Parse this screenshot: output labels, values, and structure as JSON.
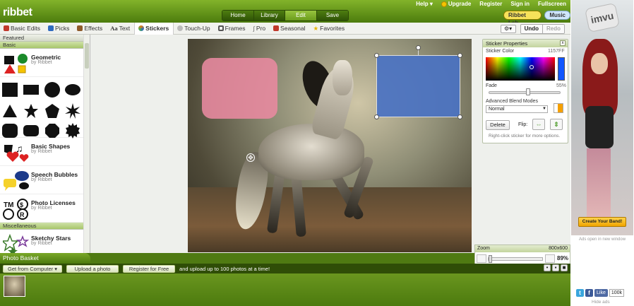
{
  "app": {
    "logo": "ribbet"
  },
  "top_menu": {
    "help": "Help ▾",
    "upgrade": "Upgrade",
    "register": "Register",
    "sign_in": "Sign in",
    "fullscreen": "Fullscreen"
  },
  "nav_tabs": [
    {
      "label": "Home",
      "active": false
    },
    {
      "label": "Library",
      "active": false
    },
    {
      "label": "Edit",
      "active": true
    },
    {
      "label": "Save",
      "active": false
    }
  ],
  "right_buttons": {
    "lab": "Ribbet Lab",
    "music": "Music"
  },
  "tools": [
    {
      "label": "Basic Edits",
      "icon": "crop-icon",
      "color": "#c0392b",
      "active": false
    },
    {
      "label": "Picks",
      "icon": "arrows-icon",
      "color": "#2f6bbf",
      "active": false
    },
    {
      "label": "Effects",
      "icon": "effects-icon",
      "color": "#8e5a2a",
      "active": false
    },
    {
      "label": "Text",
      "icon": "text-icon",
      "color": "#333333",
      "active": false
    },
    {
      "label": "Stickers",
      "icon": "stickers-icon",
      "color": "#e07a1a",
      "active": true
    },
    {
      "label": "Touch-Up",
      "icon": "touchup-icon",
      "color": "#777777",
      "active": false
    },
    {
      "label": "Frames",
      "icon": "frame-icon",
      "color": "#555555",
      "active": false
    },
    {
      "label": "Pro",
      "icon": "pro-icon",
      "color": "#666666",
      "active": false
    },
    {
      "label": "Seasonal",
      "icon": "calendar-icon",
      "color": "#c0392b",
      "active": false
    },
    {
      "label": "Favorites",
      "icon": "star-icon",
      "color": "#e6b400",
      "active": false
    }
  ],
  "toolbar": {
    "gear": "⚙▾",
    "undo": "Undo",
    "redo": "Redo"
  },
  "left_panel": {
    "featured": "Featured",
    "basic": "Basic",
    "misc": "Miscellaneous",
    "geometric": {
      "name": "Geometric",
      "by": "by Ribbet"
    },
    "basic_shapes": {
      "name": "Basic Shapes",
      "by": "by Ribbet"
    },
    "speech": {
      "name": "Speech Bubbles",
      "by": "by Ribbet"
    },
    "licenses": {
      "name": "Photo Licenses",
      "by": "by Ribbet"
    },
    "sketchy": {
      "name": "Sketchy Stars",
      "by": "by Ribbet"
    }
  },
  "sticker_props": {
    "title": "Sticker Properties",
    "color_label": "Sticker Color",
    "color_value": "1157FF",
    "fade_label": "Fade",
    "fade_value": "55%",
    "fade": 0.55,
    "blend_label": "Advanced Blend Modes",
    "blend_value": "Normal",
    "delete": "Delete",
    "flip": "Flip:",
    "hint": "Right-click sticker for more options.",
    "swatch_color": "#1157FF"
  },
  "zoom": {
    "label": "Zoom",
    "size": "800x600",
    "value": "89%",
    "level": 0.89
  },
  "basket": {
    "tab": "Photo Basket",
    "get_from": "Get from Computer",
    "upload": "Upload a photo",
    "register": "Register for Free",
    "text": "and upload up to 100 photos at a time!"
  },
  "ad": {
    "logo": "imvu",
    "button": "Create Your Band!",
    "note": "Ads open in new window",
    "like": "Like",
    "like_count": "100k",
    "hide": "Hide ads"
  }
}
